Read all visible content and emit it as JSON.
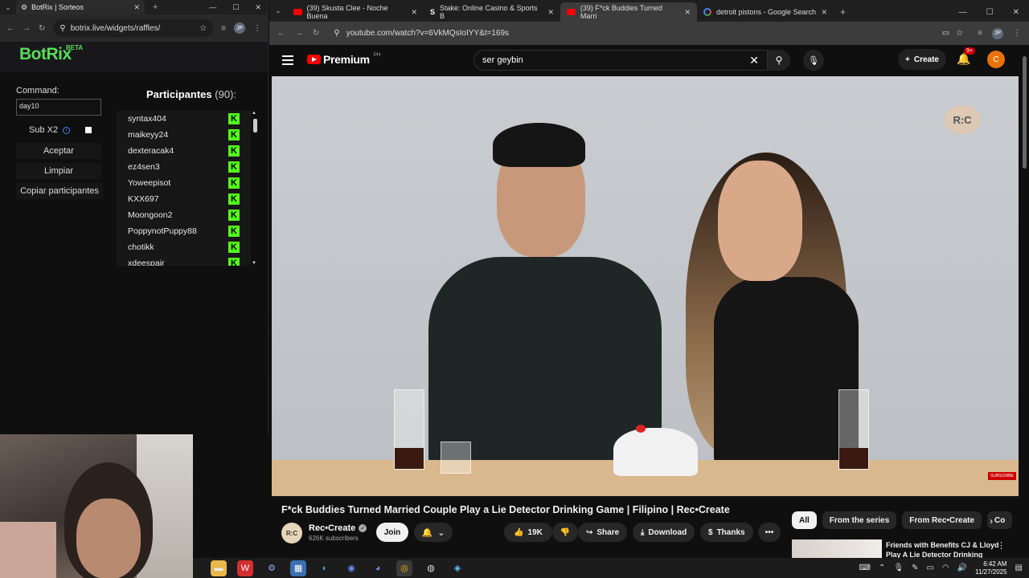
{
  "left_browser": {
    "tab_title": "BotRix | Sorteos",
    "url": "botrix.live/widgets/raffles/",
    "profile_initials": "JP"
  },
  "botrix": {
    "logo": "BotRix",
    "beta": "BETA",
    "command_label": "Command:",
    "command_value": "day10",
    "sub_x2_label": "Sub X2",
    "accept_label": "Aceptar",
    "clear_label": "Limpiar",
    "copy_label": "Copiar participantes",
    "participants_title": "Participantes",
    "participants_count": "(90):",
    "participants": [
      "syntax404",
      "maikeyy24",
      "dexteracak4",
      "ez4sen3",
      "Yoweepisot",
      "KXX697",
      "Moongoon2",
      "PoppynotPuppy88",
      "chotikk",
      "xdeespair"
    ],
    "kick_badge": "K"
  },
  "right_browser": {
    "tabs": [
      {
        "title": "(39) Skusta Clee - Noche Buena",
        "favicon": "youtube-icon"
      },
      {
        "title": "Stake: Online Casino & Sports B",
        "favicon": "stake-icon"
      },
      {
        "title": "(39) F*ck Buddies Turned Marri",
        "favicon": "youtube-icon",
        "active": true
      },
      {
        "title": "detroit pistons - Google Search",
        "favicon": "google-icon"
      }
    ],
    "url": "youtube.com/watch?v=6VkMQsIoIYY&t=169s",
    "profile_initials": "JP"
  },
  "youtube": {
    "brand": "Premium",
    "region": "PH",
    "search_value": "ser geybin",
    "create_label": "Create",
    "notification_badge": "9+",
    "avatar_initial": "C",
    "video_watermark": "R:C",
    "subscribe_watermark": "SUBSCRIBE",
    "video_title": "F*ck Buddies Turned Married Couple Play a Lie Detector Drinking Game | Filipino | Rec•Create",
    "channel_avatar": "R:C",
    "channel_name": "Rec•Create",
    "subscribers": "626K subscribers",
    "join_label": "Join",
    "like_count": "19K",
    "share_label": "Share",
    "download_label": "Download",
    "thanks_label": "Thanks",
    "chips": [
      "All",
      "From the series",
      "From Rec•Create",
      "Co"
    ],
    "rec_title": "Friends with Benefits CJ & Lloyd Play A Lie Detector Drinking"
  },
  "taskbar": {
    "time": "6:42 AM",
    "date": "11/27/2025"
  }
}
